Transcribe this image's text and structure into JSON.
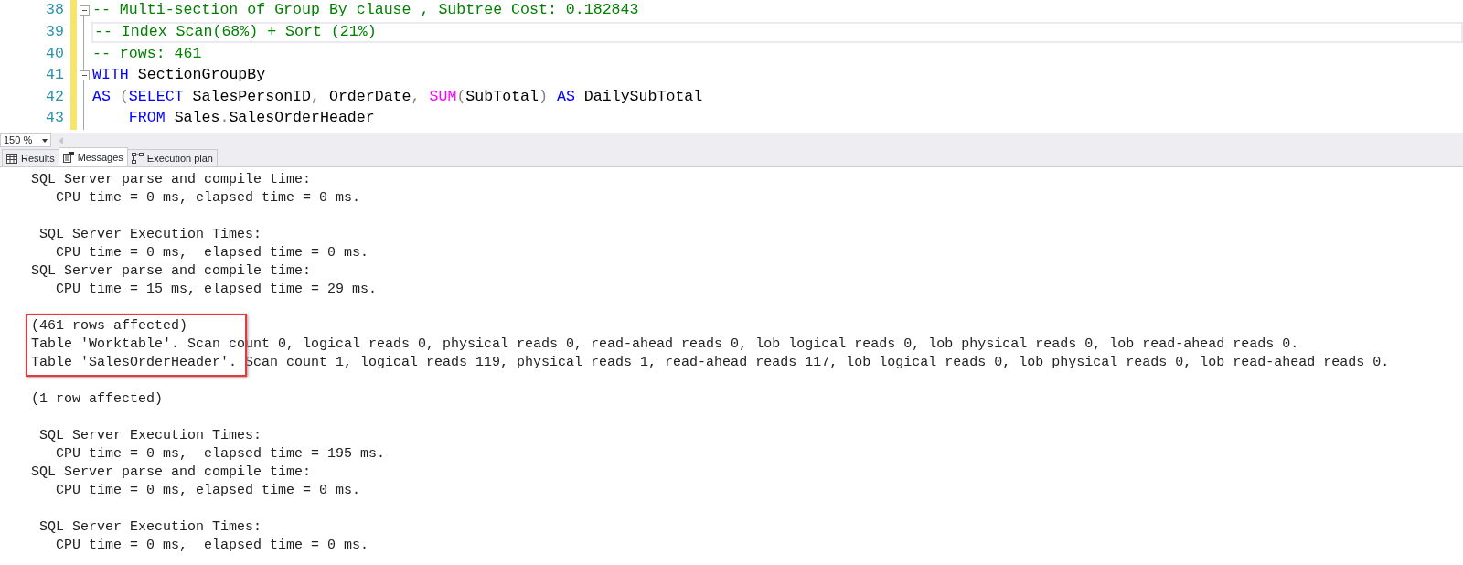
{
  "editor": {
    "lines": [
      {
        "number": "38",
        "fold": true,
        "current": false,
        "tokens": [
          {
            "kind": "comment",
            "text": "-- Multi-section of Group By clause , Subtree Cost: 0.182843"
          }
        ]
      },
      {
        "number": "39",
        "fold": false,
        "current": true,
        "tokens": [
          {
            "kind": "comment",
            "text": "-- Index Scan(68%) + Sort (21%)"
          }
        ]
      },
      {
        "number": "40",
        "fold": false,
        "current": false,
        "tokens": [
          {
            "kind": "comment",
            "text": "-- rows: 461"
          }
        ]
      },
      {
        "number": "41",
        "fold": true,
        "current": false,
        "tokens": [
          {
            "kind": "keyword",
            "text": "WITH"
          },
          {
            "kind": "plain",
            "text": " SectionGroupBy"
          }
        ]
      },
      {
        "number": "42",
        "fold": false,
        "current": false,
        "tokens": [
          {
            "kind": "keyword",
            "text": "AS"
          },
          {
            "kind": "operator",
            "text": " ("
          },
          {
            "kind": "keyword",
            "text": "SELECT"
          },
          {
            "kind": "plain",
            "text": " SalesPersonID"
          },
          {
            "kind": "operator",
            "text": ","
          },
          {
            "kind": "plain",
            "text": " OrderDate"
          },
          {
            "kind": "operator",
            "text": ", "
          },
          {
            "kind": "function",
            "text": "SUM"
          },
          {
            "kind": "operator",
            "text": "("
          },
          {
            "kind": "plain",
            "text": "SubTotal"
          },
          {
            "kind": "operator",
            "text": ") "
          },
          {
            "kind": "keyword",
            "text": "AS"
          },
          {
            "kind": "plain",
            "text": " DailySubTotal"
          }
        ]
      },
      {
        "number": "43",
        "fold": false,
        "current": false,
        "tokens": [
          {
            "kind": "keyword",
            "text": "    FROM"
          },
          {
            "kind": "plain",
            "text": " Sales"
          },
          {
            "kind": "operator",
            "text": "."
          },
          {
            "kind": "plain",
            "text": "SalesOrderHeader"
          }
        ]
      }
    ]
  },
  "zoom": {
    "value": "150 %"
  },
  "tabs": [
    {
      "label": "Results",
      "kind": "grid",
      "selected": false
    },
    {
      "label": "Messages",
      "kind": "messages",
      "selected": true
    },
    {
      "label": "Execution plan",
      "kind": "plan",
      "selected": false
    }
  ],
  "messages": [
    {
      "highlighted": false,
      "lines": [
        "SQL Server parse and compile time: ",
        "   CPU time = 0 ms, elapsed time = 0 ms."
      ]
    },
    {
      "highlighted": false,
      "lines": [
        " SQL Server Execution Times:",
        "   CPU time = 0 ms,  elapsed time = 0 ms.",
        "SQL Server parse and compile time: ",
        "   CPU time = 15 ms, elapsed time = 29 ms."
      ]
    },
    {
      "highlighted": true,
      "lines": [
        "(461 rows affected)",
        "Table 'Worktable'. Scan count 0, logical reads 0, physical reads 0, read-ahead reads 0, lob logical reads 0, lob physical reads 0, lob read-ahead reads 0.",
        "Table 'SalesOrderHeader'. Scan count 1, logical reads 119, physical reads 1, read-ahead reads 117, lob logical reads 0, lob physical reads 0, lob read-ahead reads 0."
      ]
    },
    {
      "highlighted": false,
      "lines": [
        "(1 row affected)"
      ]
    },
    {
      "highlighted": false,
      "lines": [
        " SQL Server Execution Times:",
        "   CPU time = 0 ms,  elapsed time = 195 ms.",
        "SQL Server parse and compile time: ",
        "   CPU time = 0 ms, elapsed time = 0 ms."
      ]
    },
    {
      "highlighted": false,
      "lines": [
        " SQL Server Execution Times:",
        "   CPU time = 0 ms,  elapsed time = 0 ms."
      ]
    }
  ]
}
